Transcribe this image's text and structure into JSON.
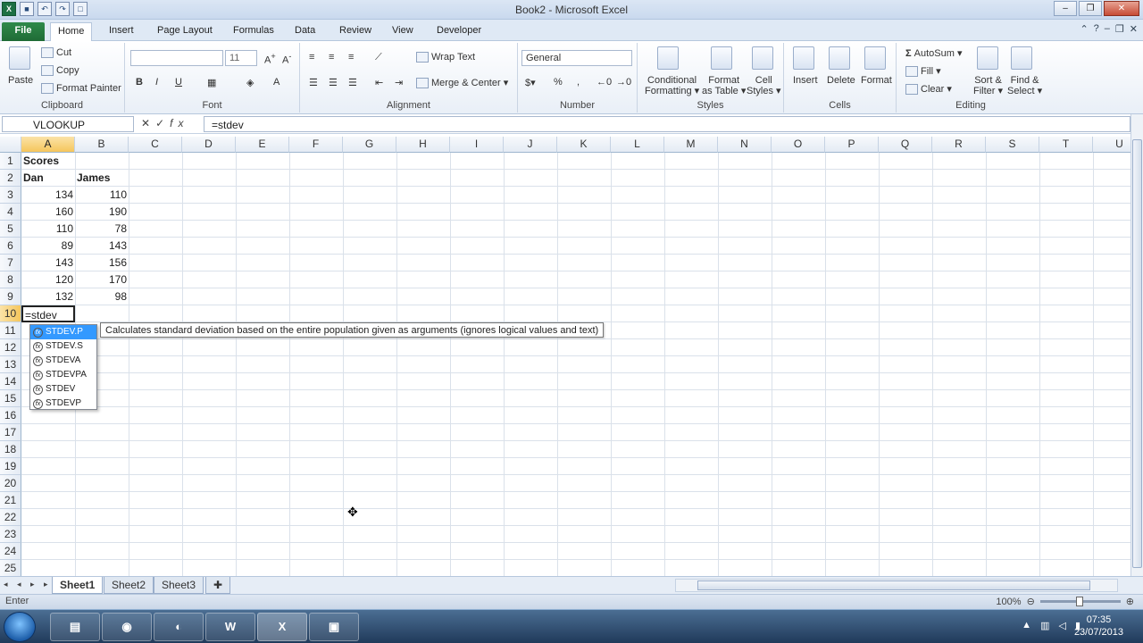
{
  "window": {
    "title": "Book2 - Microsoft Excel"
  },
  "tabs": [
    "File",
    "Home",
    "Insert",
    "Page Layout",
    "Formulas",
    "Data",
    "Review",
    "View",
    "Developer"
  ],
  "ribbon": {
    "clipboard": {
      "paste": "Paste",
      "cut": "Cut",
      "copy": "Copy",
      "format_painter": "Format Painter",
      "label": "Clipboard"
    },
    "font": {
      "size": "11",
      "label": "Font"
    },
    "alignment": {
      "wrap": "Wrap Text",
      "merge": "Merge & Center",
      "label": "Alignment"
    },
    "number": {
      "format": "General",
      "label": "Number"
    },
    "styles": {
      "conditional": "Conditional",
      "conditional2": "Formatting",
      "format_table": "Format",
      "format_table2": "as Table",
      "cell_styles": "Cell",
      "cell_styles2": "Styles",
      "label": "Styles"
    },
    "cells": {
      "insert": "Insert",
      "delete": "Delete",
      "format": "Format",
      "label": "Cells"
    },
    "editing": {
      "autosum": "AutoSum",
      "fill": "Fill",
      "clear": "Clear",
      "sort": "Sort &",
      "sort2": "Filter",
      "find": "Find &",
      "find2": "Select",
      "label": "Editing"
    }
  },
  "formula_bar": {
    "name_box": "VLOOKUP",
    "value": "=stdev",
    "fx": "fx"
  },
  "columns": [
    "A",
    "B",
    "C",
    "D",
    "E",
    "F",
    "G",
    "H",
    "I",
    "J",
    "K",
    "L",
    "M",
    "N",
    "O",
    "P",
    "Q",
    "R",
    "S",
    "T",
    "U"
  ],
  "rows": [
    "1",
    "2",
    "3",
    "4",
    "5",
    "6",
    "7",
    "8",
    "9",
    "10",
    "11",
    "12",
    "13",
    "14",
    "15",
    "16",
    "17",
    "18",
    "19",
    "20",
    "21",
    "22",
    "23",
    "24",
    "25"
  ],
  "cells": {
    "a1": "Scores",
    "a2": "Dan",
    "b2": "James",
    "a3": "134",
    "b3": "110",
    "a4": "160",
    "b4": "190",
    "a5": "110",
    "b5": "78",
    "a6": "89",
    "b6": "143",
    "a7": "143",
    "b7": "156",
    "a8": "120",
    "b8": "170",
    "a9": "132",
    "b9": "98",
    "a10": "=stdev"
  },
  "autocomplete": {
    "items": [
      "STDEV.P",
      "STDEV.S",
      "STDEVA",
      "STDEVPA",
      "STDEV",
      "STDEVP"
    ],
    "selected": 0,
    "tooltip": "Calculates standard deviation based on the entire population given as arguments (ignores logical values and text)"
  },
  "sheets": [
    "Sheet1",
    "Sheet2",
    "Sheet3"
  ],
  "status": {
    "mode": "Enter",
    "zoom": "100%"
  },
  "taskbar": {
    "time": "07:35",
    "date": "23/07/2013",
    "apps": [
      "W",
      "X"
    ]
  }
}
